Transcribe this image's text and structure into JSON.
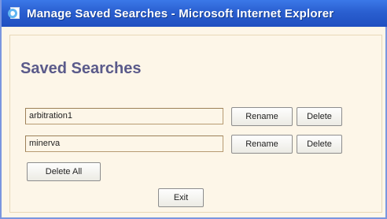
{
  "window": {
    "title": "Manage Saved Searches - Microsoft Internet Explorer"
  },
  "page": {
    "heading": "Saved Searches"
  },
  "searches": [
    {
      "name": "arbitration1",
      "rename_label": "Rename",
      "delete_label": "Delete"
    },
    {
      "name": "minerva",
      "rename_label": "Rename",
      "delete_label": "Delete"
    }
  ],
  "actions": {
    "delete_all_label": "Delete All",
    "exit_label": "Exit"
  },
  "colors": {
    "titlebar": "#2a5fd0",
    "background": "#fdf6e8",
    "heading": "#5a5a8a"
  },
  "icons": {
    "title_icon": "ie-page-icon"
  }
}
